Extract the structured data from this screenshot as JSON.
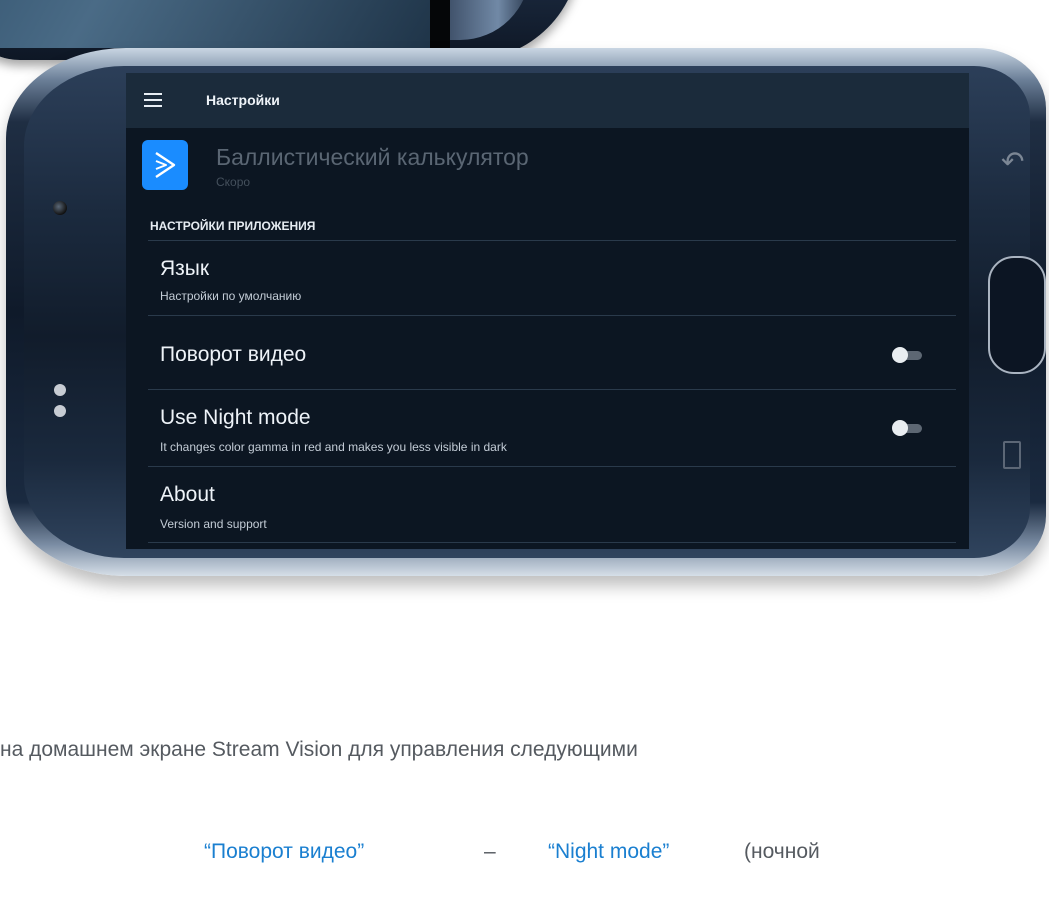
{
  "app_bar": {
    "title": "Настройки"
  },
  "app_row": {
    "title": "Баллистический калькулятор",
    "subtitle": "Скоро"
  },
  "section": {
    "header": "НАСТРОЙКИ ПРИЛОЖЕНИЯ"
  },
  "settings": [
    {
      "title": "Язык",
      "subtitle": "Настройки по умолчанию"
    },
    {
      "title": "Поворот видео",
      "toggle_on": false
    },
    {
      "title": "Use Night mode",
      "subtitle": "It changes color gamma in red and makes you less visible in dark",
      "toggle_on": false
    },
    {
      "title": "About",
      "subtitle": "Version and support"
    }
  ],
  "page_text": {
    "line1": "на домашнем экране Stream Vision для управления следующими",
    "link1": "“Поворот видео”",
    "dash": "–",
    "link2": "“Night mode”",
    "tail": "(ночной"
  },
  "colors": {
    "accent": "#1a8cff",
    "link": "#1a7fd0",
    "appbar": "#1b2b3b",
    "screen_bg": "#0c1622"
  }
}
